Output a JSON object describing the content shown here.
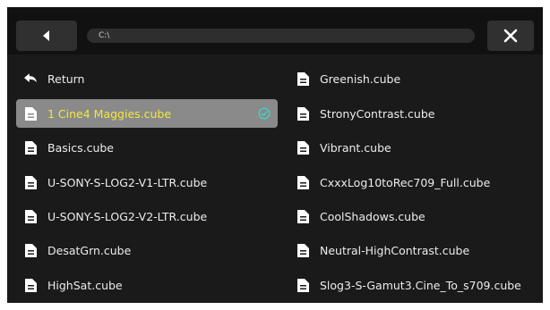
{
  "path": {
    "current": "C:\\"
  },
  "icons": {
    "back": "triangle-left-icon",
    "close": "close-icon",
    "return": "return-arrow-icon",
    "file": "document-icon",
    "selected": "check-circle-icon"
  },
  "colors": {
    "background": "#1a1a1a",
    "toolbar": "#111111",
    "button": "#303030",
    "selected_row": "#8a8a8a",
    "selected_text": "#f2e93a",
    "check_accent": "#3fd1c6"
  },
  "files": {
    "left": [
      {
        "label": "Return",
        "type": "return"
      },
      {
        "label": "1 Cine4 Maggies.cube",
        "type": "file",
        "selected": true
      },
      {
        "label": "Basics.cube",
        "type": "file"
      },
      {
        "label": "U-SONY-S-LOG2-V1-LTR.cube",
        "type": "file"
      },
      {
        "label": "U-SONY-S-LOG2-V2-LTR.cube",
        "type": "file"
      },
      {
        "label": "DesatGrn.cube",
        "type": "file"
      },
      {
        "label": "HighSat.cube",
        "type": "file"
      }
    ],
    "right": [
      {
        "label": "Greenish.cube",
        "type": "file"
      },
      {
        "label": "StronyContrast.cube",
        "type": "file"
      },
      {
        "label": "Vibrant.cube",
        "type": "file"
      },
      {
        "label": "CxxxLog10toRec709_Full.cube",
        "type": "file"
      },
      {
        "label": "CoolShadows.cube",
        "type": "file"
      },
      {
        "label": "Neutral-HighContrast.cube",
        "type": "file"
      },
      {
        "label": "Slog3-S-Gamut3.Cine_To_s709.cube",
        "type": "file"
      }
    ]
  }
}
